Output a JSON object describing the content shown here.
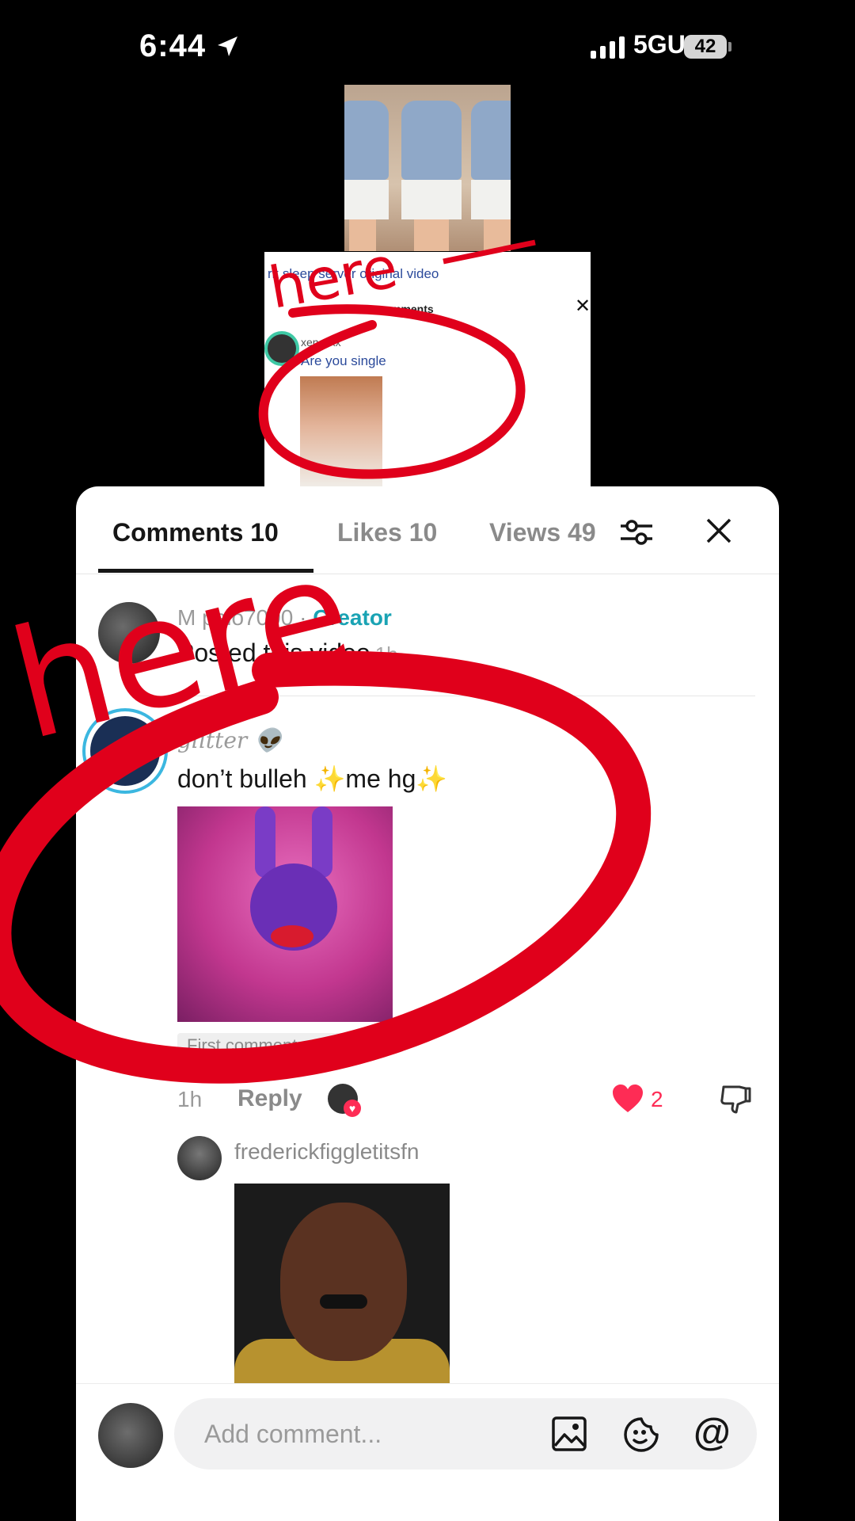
{
  "status_bar": {
    "time": "6:44",
    "network": "5GUC",
    "battery": "42"
  },
  "embed": {
    "title": "rk sleep server original video",
    "subtitle": "mments",
    "username": "xenaiixx",
    "comment": "Are you single"
  },
  "tabs": {
    "comments": "Comments 10",
    "likes": "Likes 10",
    "views": "Views 49"
  },
  "creator_post": {
    "username": "M palo7000",
    "tag": "Creator",
    "text": "Posted this video",
    "time": "1h"
  },
  "comment": {
    "username": "glitter 👽",
    "text_a": "don’t bulleh ",
    "text_b": "me hg",
    "sparkle": "✨",
    "chip": "First comment",
    "time": "1h",
    "reply_label": "Reply",
    "likes": "2"
  },
  "reply": {
    "username": "frederickfiggletitsfn"
  },
  "composer": {
    "placeholder": "Add comment..."
  },
  "annotations": {
    "label": "here"
  },
  "colors": {
    "accent_teal": "#1aa3b4",
    "like_red": "#fe2c55",
    "annotation_red": "#e0001b"
  }
}
